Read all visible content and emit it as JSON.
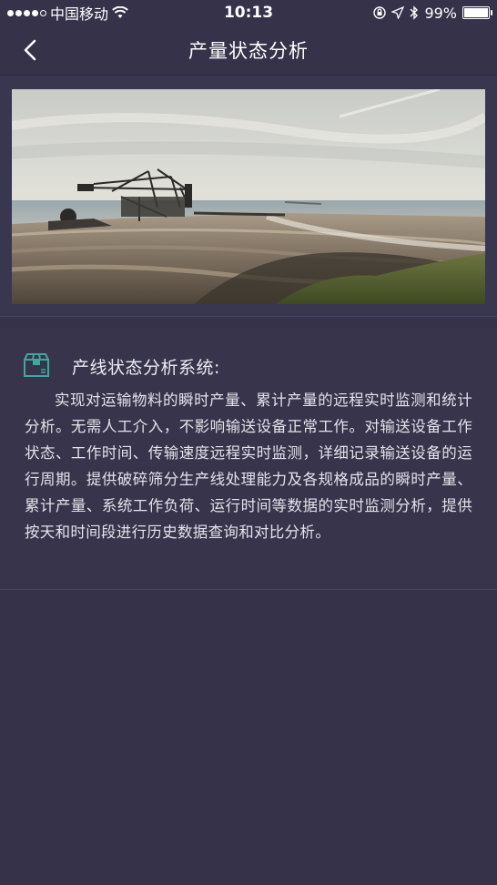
{
  "status_bar": {
    "carrier": "中国移动",
    "time": "10:13",
    "battery_percent": "99%",
    "battery_level": 0.99,
    "icons": [
      "signal-dots-icon",
      "wifi-icon",
      "orientation-lock-icon",
      "location-icon",
      "bluetooth-icon",
      "battery-icon"
    ]
  },
  "nav": {
    "title": "产量状态分析",
    "back_icon": "chevron-left-icon"
  },
  "banner": {
    "image_description_icon": "mining-excavator-landscape-image"
  },
  "description": {
    "icon": "box-icon",
    "title": "产线状态分析系统:",
    "body": "实现对运输物料的瞬时产量、累计产量的远程实时监测和统计分析。无需人工介入，不影响输送设备正常工作。对输送设备工作状态、工作时间、传输速度远程实时监测，详细记录输送设备的运行周期。提供破碎筛分生产线处理能力及各规格成品的瞬时产量、累计产量、系统工作负荷、运行时间等数据的实时监测分析，提供按天和时间段进行历史数据查询和对比分析。"
  },
  "colors": {
    "background": "#35324a",
    "card": "#37344c",
    "accent_icon": "#3fa7a0"
  }
}
